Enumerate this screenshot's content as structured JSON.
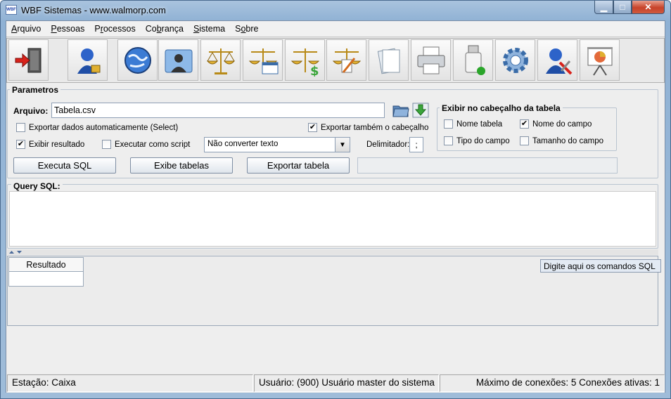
{
  "window": {
    "title": "WBF Sistemas - www.walmorp.com",
    "app_icon_text": "WBF",
    "minimize_glyph": "▁",
    "maximize_glyph": "□",
    "close_glyph": "✕"
  },
  "menu": {
    "items": [
      {
        "label": "Arquivo",
        "mnemonic": "A"
      },
      {
        "label": "Pessoas",
        "mnemonic": "P"
      },
      {
        "label": "Processos",
        "mnemonic": "r"
      },
      {
        "label": "Cobrança",
        "mnemonic": "b"
      },
      {
        "label": "Sistema",
        "mnemonic": "S"
      },
      {
        "label": "Sobre",
        "mnemonic": "o"
      }
    ]
  },
  "toolbar": {
    "icons": [
      "exit-door-icon",
      "user-lock-icon",
      "globe-icon",
      "photo-contact-icon",
      "scales-icon",
      "scales-window-icon",
      "scales-money-icon",
      "scales-edit-icon",
      "documents-icon",
      "printer-icon",
      "usb-drive-icon",
      "gear-icon",
      "user-tools-icon",
      "presentation-chart-icon"
    ]
  },
  "parametros": {
    "title": "Parametros",
    "arquivo_label": "Arquivo:",
    "arquivo_value": "Tabela.csv",
    "exportar_auto_label": "Exportar dados automaticamente (Select)",
    "exportar_auto_checked": false,
    "exportar_cabecalho_label": "Exportar também o cabeçalho",
    "exportar_cabecalho_checked": true,
    "exibir_resultado_label": "Exibir resultado",
    "exibir_resultado_checked": true,
    "executar_script_label": "Executar como script",
    "executar_script_checked": false,
    "conversao_selected": "Não converter texto",
    "delimitador_label": "Delimitador:",
    "delimitador_value": ";",
    "buttons": {
      "executa_sql": "Executa SQL",
      "exibe_tabelas": "Exibe tabelas",
      "exportar_tabela": "Exportar tabela"
    }
  },
  "cabecalho": {
    "title": "Exibir no cabeçalho da tabela",
    "nome_tabela_label": "Nome tabela",
    "nome_tabela_checked": false,
    "nome_campo_label": "Nome do campo",
    "nome_campo_checked": true,
    "tipo_campo_label": "Tipo do campo",
    "tipo_campo_checked": false,
    "tamanho_campo_label": "Tamanho do campo",
    "tamanho_campo_checked": false
  },
  "query": {
    "title": "Query SQL:",
    "value": ""
  },
  "results": {
    "tab_label": "Resultado",
    "tooltip": "Digite aqui os comandos SQL"
  },
  "statusbar": {
    "estacao": "Estação: Caixa",
    "usuario": "Usuário: (900) Usuário master do sistema",
    "conexoes": "Máximo de conexões: 5 Conexões ativas: 1"
  },
  "colors": {
    "titlebar": "#9fbcd9",
    "close_button": "#c7432a",
    "panel_bg": "#eeeeee",
    "border": "#b9c4d0"
  }
}
